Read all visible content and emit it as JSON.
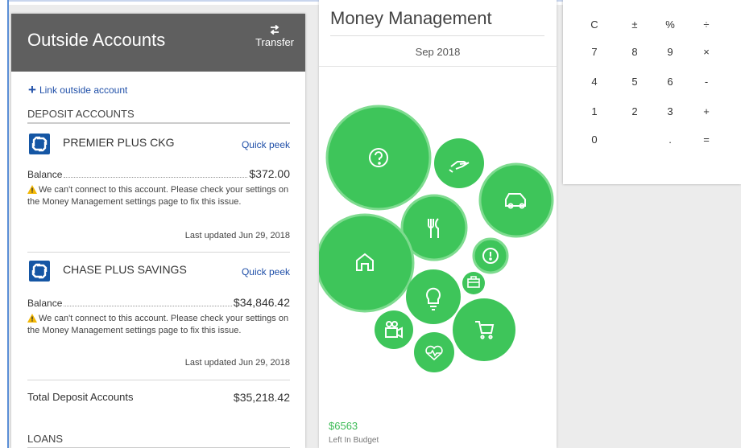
{
  "accounts": {
    "title": "Outside Accounts",
    "transfer_label": "Transfer",
    "link_label": "Link outside account",
    "deposit_header": "DEPOSIT ACCOUNTS",
    "items": [
      {
        "name": "PREMIER PLUS CKG",
        "quick_peek": "Quick peek",
        "balance_label": "Balance",
        "balance": "$372.00",
        "warning": "We can't connect to this account. Please check your settings on the Money Management settings page to fix this issue.",
        "updated": "Last updated Jun 29, 2018"
      },
      {
        "name": "CHASE PLUS SAVINGS",
        "quick_peek": "Quick peek",
        "balance_label": "Balance",
        "balance": "$34,846.42",
        "warning": "We can't connect to this account. Please check your settings on the Money Management settings page to fix this issue.",
        "updated": "Last updated Jun 29, 2018"
      }
    ],
    "total_label": "Total Deposit Accounts",
    "total_value": "$35,218.42",
    "loans_header": "LOANS"
  },
  "money": {
    "title": "Money Management",
    "month": "Sep 2018",
    "left_amount": "$6563",
    "left_label": "Left In Budget",
    "bubble_color": "#3ec55a",
    "bubbles": [
      "help-icon",
      "hand-money-icon",
      "car-icon",
      "dining-icon",
      "alert-icon",
      "home-icon",
      "briefcase-icon",
      "lightbulb-icon",
      "shopping-cart-icon",
      "video-camera-icon",
      "health-heart-icon"
    ]
  },
  "calculator": {
    "keys": [
      [
        "C",
        "±",
        "%",
        "÷"
      ],
      [
        "7",
        "8",
        "9",
        "×"
      ],
      [
        "4",
        "5",
        "6",
        "-"
      ],
      [
        "1",
        "2",
        "3",
        "+"
      ],
      [
        "0",
        "",
        ".",
        "="
      ]
    ]
  },
  "colors": {
    "header": "#5f5f5f",
    "link": "#1f4fa8",
    "warning": "#f2b705",
    "bank": "#1556a4"
  }
}
